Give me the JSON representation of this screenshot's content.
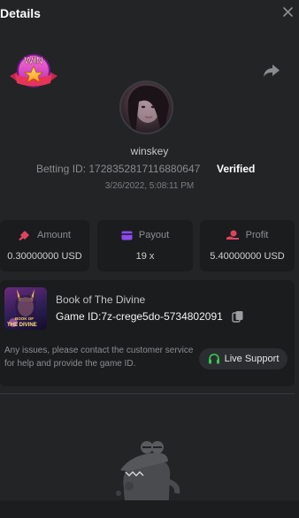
{
  "header": {
    "title": "Details"
  },
  "user": {
    "username": "winskey",
    "betting_id_label": "Betting ID:",
    "betting_id": "1728352817116880647",
    "verified": "Verified",
    "datetime": "3/26/2022, 5:08:11 PM"
  },
  "badge": {
    "text": "WIN"
  },
  "stats": [
    {
      "label": "Amount",
      "value": "0.30000000 USD",
      "icon": "bet-icon",
      "color": "#e0455f"
    },
    {
      "label": "Payout",
      "value": "19 x",
      "icon": "card-icon",
      "color": "#8d4be8"
    },
    {
      "label": "Profit",
      "value": "5.40000000 USD",
      "icon": "coins-icon",
      "color": "#e0455f"
    }
  ],
  "game": {
    "name": "Book of The Divine",
    "id_label": "Game ID:",
    "id": "7z-crege5do-5734802091",
    "thumb_text_1": "BOOK OF",
    "thumb_text_2": "THE DIVINE"
  },
  "support": {
    "issue_text": "Any issues, please contact the customer service for help and provide the game ID.",
    "button_label": "Live Support",
    "icon_color": "#2fcf4e"
  },
  "colors": {
    "background": "#232426",
    "card": "#1b1c1e",
    "accent_green": "#2fcf4e"
  }
}
